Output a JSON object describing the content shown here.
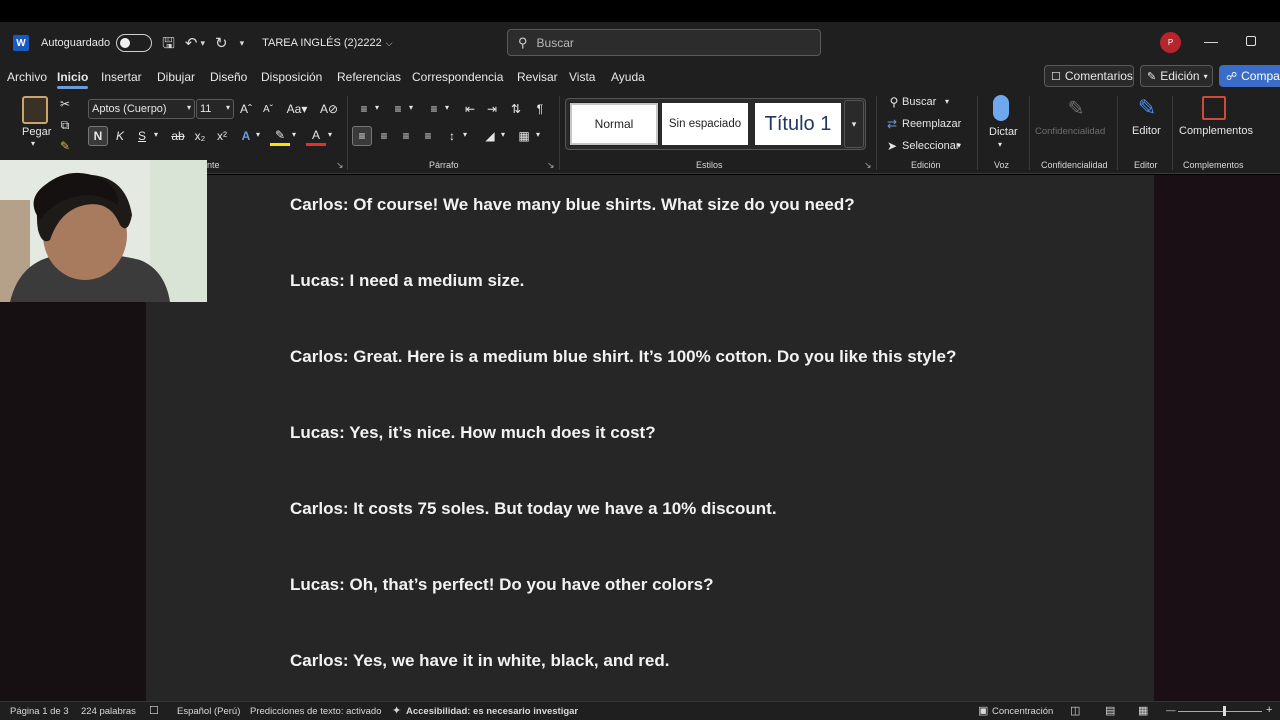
{
  "titlebar": {
    "autosave_label": "Autoguardado",
    "doc_title": "TAREA INGLÉS  (2)2222",
    "search_placeholder": "Buscar",
    "avatar_initial": "P"
  },
  "menu": {
    "tabs": [
      "Archivo",
      "Inicio",
      "Insertar",
      "Dibujar",
      "Diseño",
      "Disposición",
      "Referencias",
      "Correspondencia",
      "Revisar",
      "Vista",
      "Ayuda"
    ],
    "active_tab": "Inicio",
    "comments": "Comentarios",
    "editing": "Edición",
    "share": "Compar"
  },
  "ribbon": {
    "paste": "Pegar",
    "font_name": "Aptos (Cuerpo)",
    "font_size": "11",
    "bold": "N",
    "italic": "K",
    "underline": "S",
    "font_group_partial": "nte",
    "paragraph_group": "Párrafo",
    "styles_group": "Estilos",
    "styles": [
      "Normal",
      "Sin espaciado",
      "Título 1"
    ],
    "find": "Buscar",
    "replace": "Reemplazar",
    "select": "Seleccionar",
    "edit_group": "Edición",
    "dictate": "Dictar",
    "voice_group": "Voz",
    "sensitivity": "Confidencialidad",
    "sensitivity_group": "Confidencialidad",
    "editor": "Editor",
    "editor_group": "Editor",
    "addins": "Complementos",
    "addins_group": "Complementos"
  },
  "document": {
    "lines": [
      "Carlos: Of course! We have many blue shirts. What size do you need?",
      "Lucas: I need a medium size.",
      "Carlos: Great. Here is a medium blue shirt. It’s 100% cotton. Do you like this style?",
      "Lucas: Yes, it’s nice. How much does it cost?",
      "Carlos: It costs 75 soles. But today we have a 10% discount.",
      "Lucas: Oh, that’s perfect! Do you have other colors?",
      "Carlos: Yes, we have it in white, black, and red."
    ]
  },
  "status": {
    "page": "Página 1 de 3",
    "words": "224 palabras",
    "language": "Español (Perú)",
    "predictions": "Predicciones de texto: activado",
    "accessibility": "Accesibilidad: es necesario investigar",
    "focus": "Concentración"
  },
  "colors": {
    "accent": "#3a6cc8",
    "document_bg": "#262626",
    "ribbon_bg": "#1f1f1f",
    "avatar": "#b4262b"
  }
}
